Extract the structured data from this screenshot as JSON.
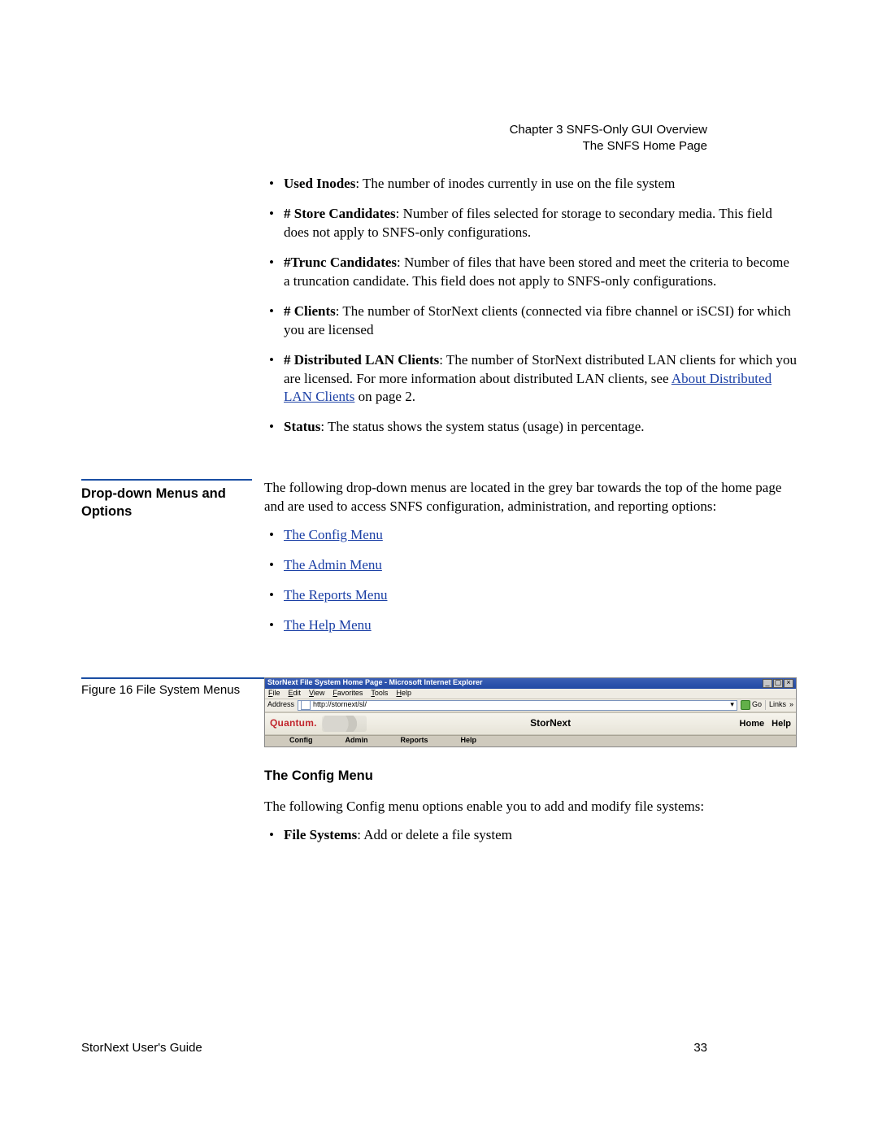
{
  "header": {
    "chapter": "Chapter 3  SNFS-Only GUI Overview",
    "section": "The SNFS Home Page"
  },
  "bullets_top": [
    {
      "term": "Used Inodes",
      "desc": ": The number of inodes currently in use on the file system"
    },
    {
      "term": "# Store Candidates",
      "desc": ": Number of files selected for storage to secondary media. This field does not apply to SNFS-only configurations."
    },
    {
      "term": "#Trunc Candidates",
      "desc": ": Number of files that have been stored and meet the criteria to become a truncation candidate. This field does not apply to SNFS-only configurations."
    },
    {
      "term": "# Clients",
      "desc": ": The number of StorNext clients (connected via fibre channel or iSCSI) for which you are licensed"
    },
    {
      "term": "# Distributed LAN Clients",
      "desc_pre": ": The number of StorNext distributed LAN clients for which you are licensed. For more information about distributed LAN clients, see ",
      "link": "About Distributed LAN Clients",
      "desc_post": " on page  2."
    },
    {
      "term": "Status",
      "desc": ": The status shows the system status (usage) in percentage."
    }
  ],
  "dropdown": {
    "side_heading": "Drop-down Menus and Options",
    "intro": "The following drop-down menus are located in the grey bar towards the top of the home page and are used to access SNFS configuration, administration, and reporting options:",
    "links": [
      "The Config Menu",
      "The Admin Menu",
      "The Reports Menu",
      "The Help Menu"
    ]
  },
  "figure": {
    "caption": "Figure 16  File System Menus",
    "window_title": "StorNext File System Home Page - Microsoft Internet Explorer",
    "menubar": [
      "File",
      "Edit",
      "View",
      "Favorites",
      "Tools",
      "Help"
    ],
    "address_label": "Address",
    "address_value": "http://stornext/sl/",
    "go_label": "Go",
    "links_label": "Links",
    "brand": "Quantum.",
    "center_title": "StorNext",
    "right_links": [
      "Home",
      "Help"
    ],
    "nav": [
      "Config",
      "Admin",
      "Reports",
      "Help"
    ]
  },
  "config_section": {
    "heading": "The Config Menu",
    "intro": "The following Config menu options enable you to add and modify file systems:",
    "bullets": [
      {
        "term": "File Systems",
        "desc": ": Add or delete a file system"
      }
    ]
  },
  "footer": {
    "left": "StorNext User's Guide",
    "right": "33"
  }
}
